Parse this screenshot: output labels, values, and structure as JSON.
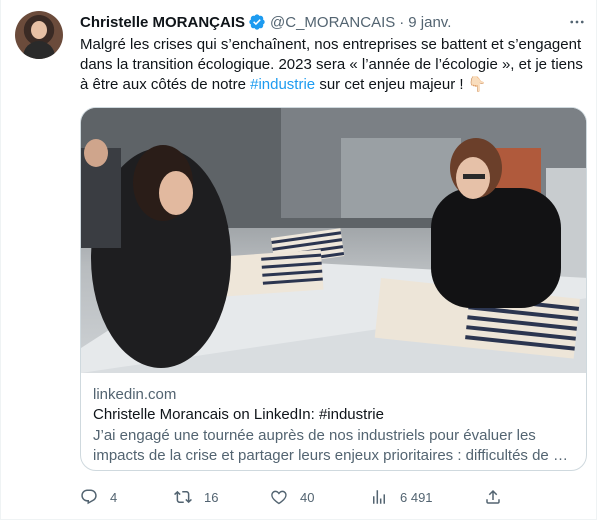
{
  "tweet": {
    "author_name": "Christelle MORANÇAIS",
    "handle": "@C_MORANCAIS",
    "separator": "·",
    "date": "9 janv.",
    "text_part1": "Malgré les crises qui s’enchaînent, nos entreprises se battent et s’engagent dans la transition écologique. 2023 sera « l’année de l’écologie », et je tiens à être aux côtés de notre ",
    "hashtag": "#industrie",
    "text_part2": " sur cet enjeu majeur ! 👇🏻"
  },
  "card": {
    "domain": "linkedin.com",
    "title": "Christelle Morancais on LinkedIn: #industrie",
    "description": "J’ai engagé une tournée auprès de nos industriels pour évaluer les impacts de la crise et partager leurs enjeux prioritaires : difficultés de …"
  },
  "actions": {
    "replies": "4",
    "retweets": "16",
    "likes": "40",
    "views": "6 491"
  },
  "icons": {
    "verified": "verified-badge-icon",
    "more": "more-horizontal-icon",
    "reply": "reply-icon",
    "retweet": "retweet-icon",
    "like": "heart-icon",
    "views": "views-chart-icon",
    "share": "share-icon"
  },
  "colors": {
    "accent": "#1d9bf0",
    "secondary_text": "#536471",
    "primary_text": "#0f1419",
    "border": "#cfd9de"
  }
}
